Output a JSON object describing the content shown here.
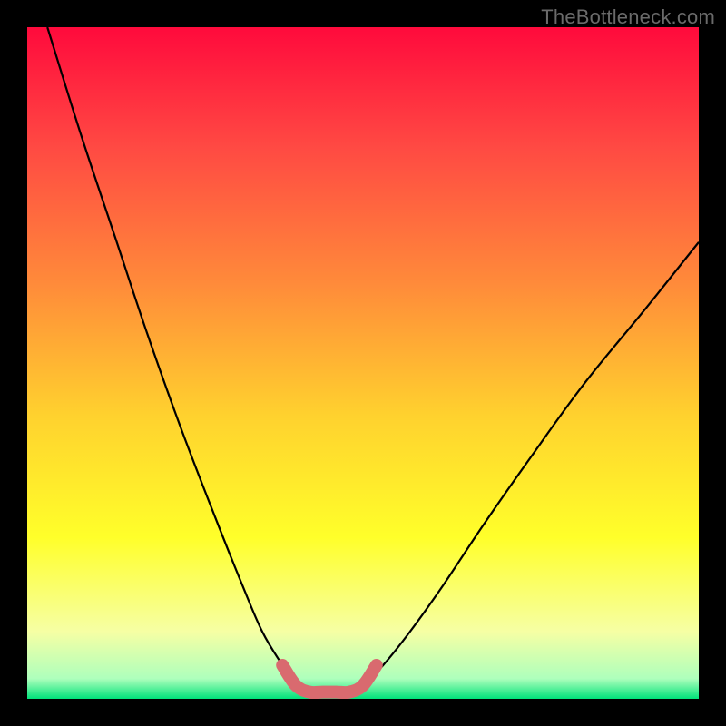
{
  "watermark": "TheBottleneck.com",
  "chart_data": {
    "type": "line",
    "title": "",
    "xlabel": "",
    "ylabel": "",
    "xlim": [
      0,
      100
    ],
    "ylim": [
      0,
      100
    ],
    "series": [
      {
        "name": "curve-left",
        "x": [
          3,
          8,
          13,
          18,
          23,
          28,
          32,
          35,
          38,
          40
        ],
        "y": [
          100,
          84,
          69,
          54,
          40,
          27,
          17,
          10,
          5,
          2
        ]
      },
      {
        "name": "curve-right",
        "x": [
          50,
          53,
          57,
          62,
          68,
          75,
          83,
          92,
          100
        ],
        "y": [
          2,
          5,
          10,
          17,
          26,
          36,
          47,
          58,
          68
        ]
      },
      {
        "name": "valley-highlight",
        "x": [
          38,
          40,
          42,
          44,
          46,
          48,
          50,
          52
        ],
        "y": [
          5,
          2,
          1,
          1,
          1,
          1,
          2,
          5
        ]
      }
    ],
    "gradient_bands": [
      {
        "y0": 100,
        "y1": 82,
        "c0": "#ff0a3c",
        "c1": "#ff4a43"
      },
      {
        "y0": 82,
        "y1": 62,
        "c0": "#ff4a43",
        "c1": "#ff8a3a"
      },
      {
        "y0": 62,
        "y1": 42,
        "c0": "#ff8a3a",
        "c1": "#ffd22e"
      },
      {
        "y0": 42,
        "y1": 24,
        "c0": "#ffd22e",
        "c1": "#ffff2a"
      },
      {
        "y0": 24,
        "y1": 10,
        "c0": "#ffff2a",
        "c1": "#f6ffa4"
      },
      {
        "y0": 10,
        "y1": 3,
        "c0": "#f6ffa4",
        "c1": "#aeffbc"
      },
      {
        "y0": 3,
        "y1": 0,
        "c0": "#aeffbc",
        "c1": "#00e27a"
      }
    ]
  }
}
